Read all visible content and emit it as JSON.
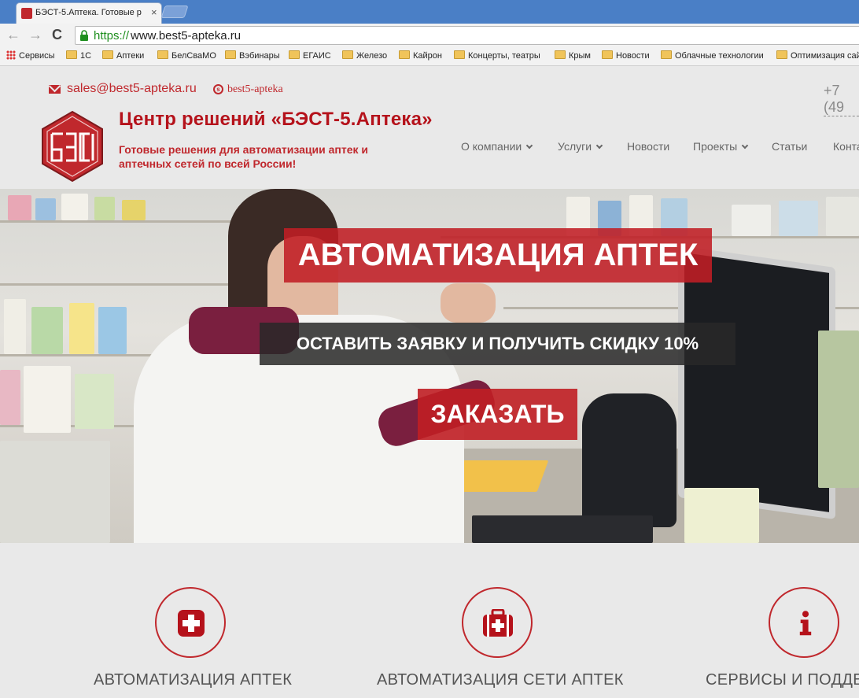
{
  "browser": {
    "tab_title": "БЭСТ-5.Аптека. Готовые р",
    "tab_close": "×",
    "url_protocol": "https://",
    "url_rest": "www.best5-apteka.ru",
    "nav": {
      "back": "←",
      "forward": "→",
      "reload": "C"
    },
    "bookmarks": [
      "Сервисы",
      "1С",
      "Аптеки",
      "БелСваМО",
      "Вэбинары",
      "ЕГАИС",
      "Железо",
      "Кайрон",
      "Концерты, театры",
      "Крым",
      "Новости",
      "Облачные технологии",
      "Оптимизация сай"
    ]
  },
  "contacts": {
    "email": "sales@best5-apteka.ru",
    "skype": "best5-apteka",
    "phone": "+7 (49"
  },
  "brand": {
    "name": "Центр решений «БЭСТ-5.Аптека»",
    "tagline": "Готовые решения для автоматизации аптек и аптечных сетей по всей России!",
    "logo_icon": "bestm-logo",
    "accent_color": "#c0282d"
  },
  "menu": [
    {
      "label": "О компании",
      "has_dropdown": true
    },
    {
      "label": "Услуги",
      "has_dropdown": true
    },
    {
      "label": "Новости",
      "has_dropdown": false
    },
    {
      "label": "Проекты",
      "has_dropdown": true
    },
    {
      "label": "Статьи",
      "has_dropdown": false
    },
    {
      "label": "Конта",
      "has_dropdown": false
    }
  ],
  "hero": {
    "title": "АВТОМАТИЗАЦИЯ АПТЕК",
    "subtitle": "ОСТАВИТЬ ЗАЯВКУ И ПОЛУЧИТЬ СКИДКУ 10%",
    "button": "ЗАКАЗАТЬ"
  },
  "features": [
    {
      "title": "АВТОМАТИЗАЦИЯ АПТЕК",
      "icon": "medical-cross-icon"
    },
    {
      "title": "АВТОМАТИЗАЦИЯ СЕТИ АПТЕК",
      "icon": "first-aid-kit-icon"
    },
    {
      "title": "СЕРВИСЫ И ПОДДЕ",
      "icon": "info-icon"
    }
  ]
}
